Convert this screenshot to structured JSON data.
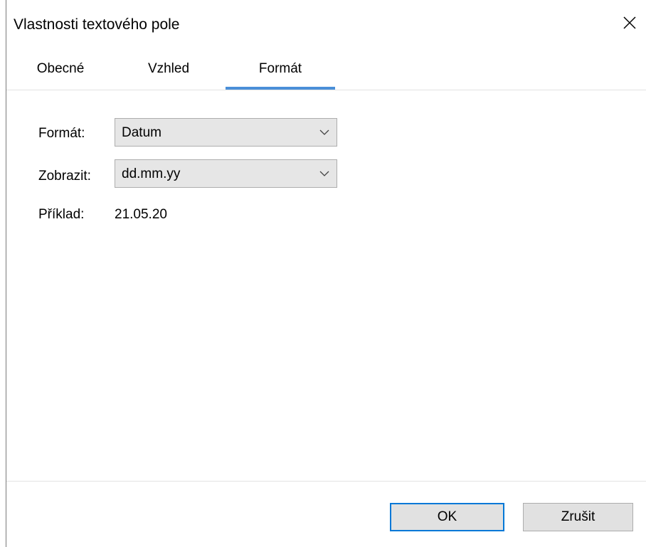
{
  "window": {
    "title": "Vlastnosti textového pole"
  },
  "icons": {
    "close": "close-icon",
    "dropdown": "chevron-down-icon"
  },
  "colors": {
    "accent": "#0078d7",
    "tab_indicator": "#4a8fd8"
  },
  "tabs": [
    {
      "label": "Obecné",
      "selected": false
    },
    {
      "label": "Vzhled",
      "selected": false
    },
    {
      "label": "Formát",
      "selected": true
    }
  ],
  "form": {
    "format_label": "Formát:",
    "format_value": "Datum",
    "display_label": "Zobrazit:",
    "display_value": "dd.mm.yy",
    "example_label": "Příklad:",
    "example_value": "21.05.20"
  },
  "buttons": {
    "ok": "OK",
    "cancel": "Zrušit"
  }
}
